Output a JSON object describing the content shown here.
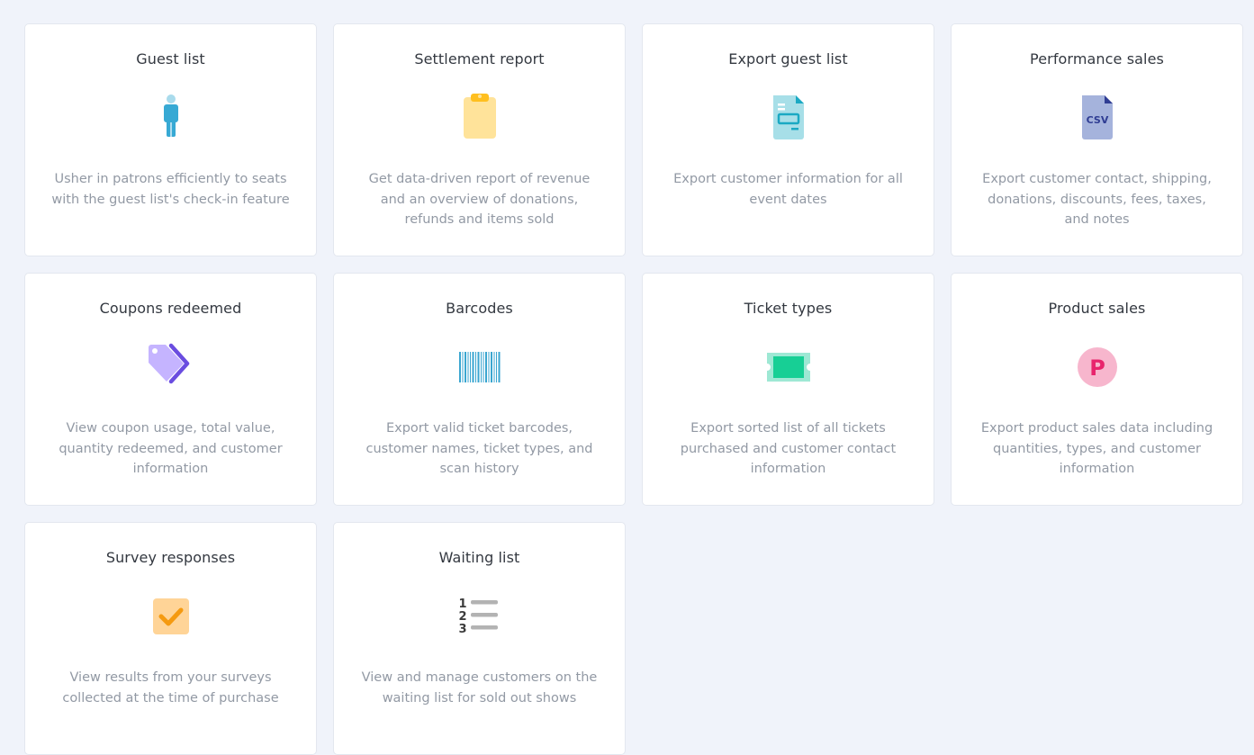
{
  "cards": [
    {
      "title": "Guest list",
      "icon": "person-icon",
      "description": "Usher in patrons efficiently to seats with the guest list's check-in feature"
    },
    {
      "title": "Settlement report",
      "icon": "clipboard-icon",
      "description": "Get data-driven report of revenue and an overview of donations, refunds and items sold"
    },
    {
      "title": "Export guest list",
      "icon": "document-export-icon",
      "description": "Export customer information for all event dates"
    },
    {
      "title": "Performance sales",
      "icon": "csv-file-icon",
      "description": "Export customer contact, shipping, donations, discounts, fees, taxes, and notes"
    },
    {
      "title": "Coupons redeemed",
      "icon": "tag-icon",
      "description": "View coupon usage, total value, quantity redeemed, and customer information"
    },
    {
      "title": "Barcodes",
      "icon": "barcode-icon",
      "description": "Export valid ticket barcodes, customer names, ticket types, and scan history"
    },
    {
      "title": "Ticket types",
      "icon": "ticket-icon",
      "description": "Export sorted list of all tickets purchased and customer contact information"
    },
    {
      "title": "Product sales",
      "icon": "product-p-icon",
      "description": "Export product sales data including quantities, types, and customer information"
    },
    {
      "title": "Survey responses",
      "icon": "checkbox-icon",
      "description": "View results from your surveys collected at the time of purchase"
    },
    {
      "title": "Waiting list",
      "icon": "numbered-list-icon",
      "description": "View and manage customers on the waiting list for sold out shows"
    }
  ],
  "icon_text": {
    "csv": "CSV",
    "product": "P",
    "list_numbers": [
      "1",
      "2",
      "3"
    ]
  },
  "colors": {
    "background": "#f0f3fa",
    "card": "#ffffff",
    "title": "#333840",
    "description": "#9299a4"
  }
}
